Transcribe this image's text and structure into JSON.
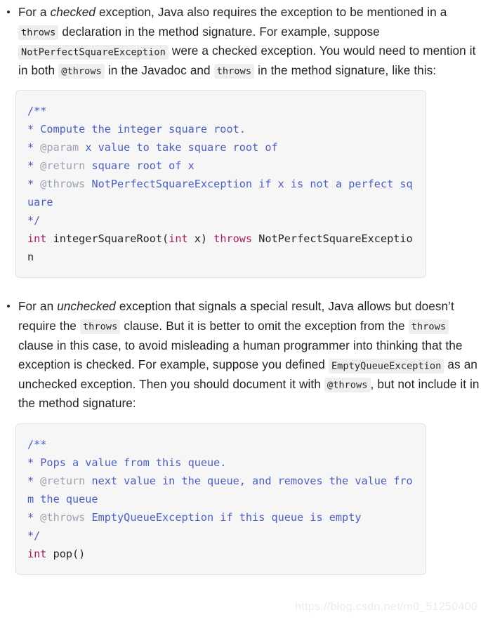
{
  "document": {
    "watermark": "https://blog.csdn.net/m0_51250400",
    "colors": {
      "text": "#1f2328",
      "inline_code_bg": "#eeeeee",
      "code_block_bg": "#f6f6f6",
      "code_block_border": "#e3e3e3",
      "comment": "#4b5fc0",
      "doc_tag": "#9aa3b4",
      "keyword": "#a71d5d",
      "watermark": "#e9ecef"
    },
    "bullets": [
      {
        "id": "checked-exception",
        "paragraph": {
          "p1": "For a ",
          "em1": "checked",
          "p2": " exception, Java also requires the exception to be mentioned in a ",
          "code1": "throws",
          "p3": " declaration in the method signature. For example, suppose ",
          "code2": "NotPerfectSquareException",
          "p4": " were a checked exception. You would need to mention it in both ",
          "code3": "@throws",
          "p5": " in the Javadoc and ",
          "code4": "throws",
          "p6": " in the method signature, like this:"
        },
        "code_block": {
          "lines": [
            {
              "comment": "/**"
            },
            {
              "comment": "* Compute the integer square root."
            },
            {
              "star": "* ",
              "tag": "@param",
              "comment": " x value to take square root of"
            },
            {
              "star": "* ",
              "tag": "@return",
              "comment": " square root of x"
            },
            {
              "star": "* ",
              "tag": "@throws",
              "comment": " NotPerfectSquareException if x is not a perfect square"
            },
            {
              "comment": "*/"
            },
            {
              "code": [
                {
                  "t": "int",
                  "c": "keyword"
                },
                {
                  "t": " integerSquareRoot(",
                  "c": "plain"
                },
                {
                  "t": "int",
                  "c": "keyword"
                },
                {
                  "t": " x) ",
                  "c": "plain"
                },
                {
                  "t": "throws",
                  "c": "keyword"
                },
                {
                  "t": " NotPerfectSquareException",
                  "c": "plain"
                }
              ]
            }
          ],
          "plain_text": "/**\n* Compute the integer square root.\n* @param x value to take square root of\n* @return square root of x\n* @throws NotPerfectSquareException if x is not a perfect square\n*/\nint integerSquareRoot(int x) throws NotPerfectSquareException"
        }
      },
      {
        "id": "unchecked-exception",
        "paragraph": {
          "p1": "For an ",
          "em1": "unchecked",
          "p2": " exception that signals a special result, Java allows but doesn’t require the ",
          "code1": "throws",
          "p3": " clause. But it is better to omit the exception from the ",
          "code2": "throws",
          "p4": " clause in this case, to avoid misleading a human programmer into thinking that the exception is checked. For example, suppose you defined ",
          "code3": "EmptyQueueException",
          "p5": " as an unchecked exception. Then you should document it with ",
          "code4": "@throws",
          "p6": ", but not include it in the method signature:"
        },
        "code_block": {
          "lines": [
            {
              "comment": "/**"
            },
            {
              "comment": "* Pops a value from this queue."
            },
            {
              "star": "* ",
              "tag": "@return",
              "comment": " next value in the queue, and removes the value from the queue"
            },
            {
              "star": "* ",
              "tag": "@throws",
              "comment": " EmptyQueueException if this queue is empty"
            },
            {
              "comment": "*/"
            },
            {
              "code": [
                {
                  "t": "int",
                  "c": "keyword"
                },
                {
                  "t": " pop()",
                  "c": "plain"
                }
              ]
            }
          ],
          "plain_text": "/**\n* Pops a value from this queue.\n* @return next value in the queue, and removes the value from the queue\n* @throws EmptyQueueException if this queue is empty\n*/\nint pop()"
        }
      }
    ]
  }
}
